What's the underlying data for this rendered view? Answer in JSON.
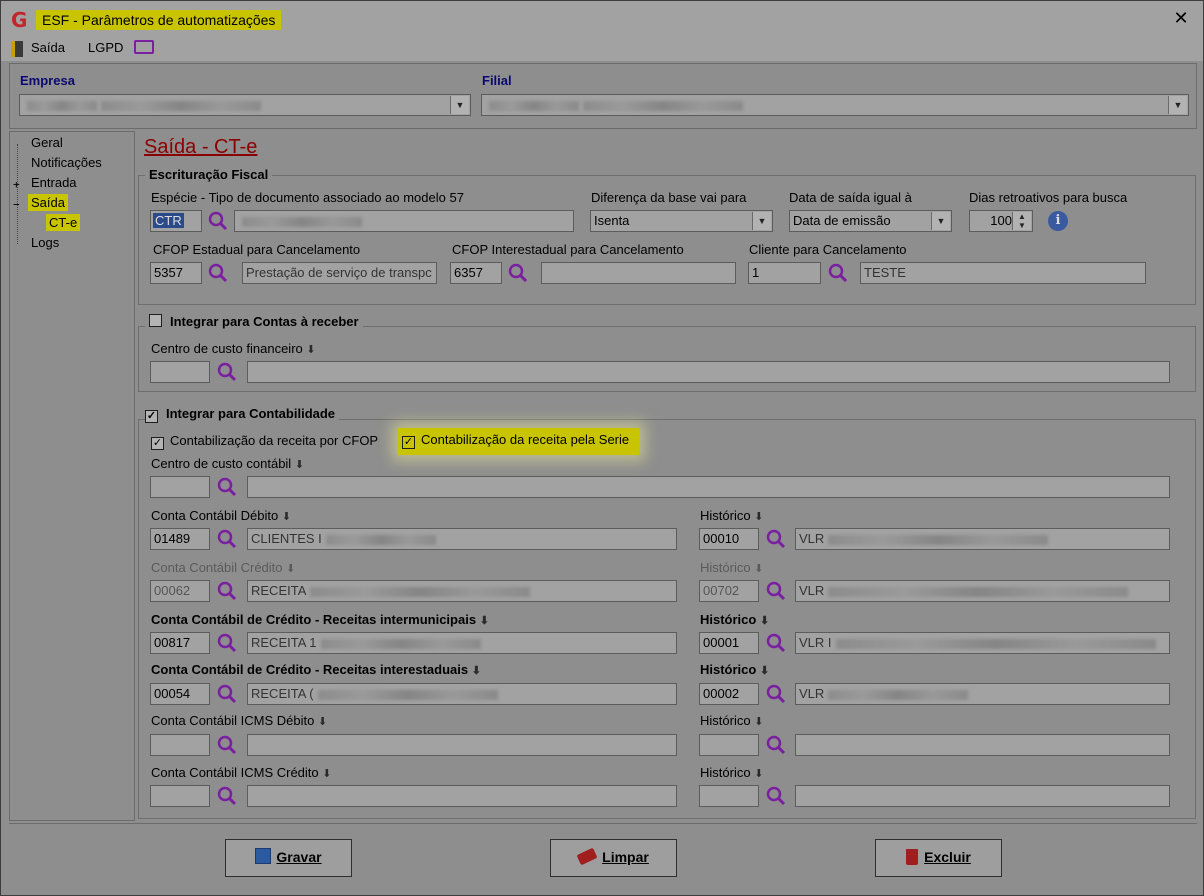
{
  "window": {
    "title": "ESF - Parâmetros de automatizações",
    "close_glyph": "✕"
  },
  "menu": {
    "saida": "Saída",
    "lgpd": "LGPD"
  },
  "header": {
    "empresa_label": "Empresa",
    "filial_label": "Filial"
  },
  "tree": {
    "items": [
      "Geral",
      "Notificações",
      "Entrada",
      "Saída",
      "CT-e",
      "Logs"
    ]
  },
  "page": {
    "title": "Saída - CT-e"
  },
  "escrituracao": {
    "title": "Escrituração Fiscal",
    "especie_label": "Espécie - Tipo de documento associado ao modelo 57",
    "especie_code": "CTR",
    "diferenca_label": "Diferença da base vai para",
    "diferenca_value": "Isenta",
    "data_saida_label": "Data de saída igual à",
    "data_saida_value": "Data de emissão",
    "dias_label": "Dias retroativos para busca",
    "dias_value": "100",
    "cfop_est_label": "CFOP Estadual para  Cancelamento",
    "cfop_est_code": "5357",
    "cfop_est_desc": "Prestação de serviço de transpc",
    "cfop_inter_label": "CFOP Interestadual para  Cancelamento",
    "cfop_inter_code": "6357",
    "cliente_label": "Cliente para Cancelamento",
    "cliente_code": "1",
    "cliente_desc": "TESTE"
  },
  "contas_receber": {
    "title": "Integrar para Contas à receber",
    "checked": false,
    "centro_label": "Centro de custo financeiro"
  },
  "contabilidade": {
    "title": "Integrar para Contabilidade",
    "checked": true,
    "opt_cfop": "Contabilização da receita por CFOP",
    "opt_serie": "Contabilização da receita pela Serie",
    "centro_label": "Centro de custo contábil",
    "debito_label": "Conta Contábil Débito",
    "debito_code": "01489",
    "debito_desc": "CLIENTES I",
    "hist1_label": "Histórico",
    "hist1_code": "00010",
    "hist1_desc": "VLR",
    "credito_label": "Conta Contábil Crédito",
    "credito_code": "00062",
    "credito_desc": "RECEITA",
    "hist2_label": "Histórico",
    "hist2_code": "00702",
    "hist2_desc": "VLR",
    "inter_mun_label": "Conta Contábil de Crédito - Receitas intermunicipais",
    "inter_mun_code": "00817",
    "inter_mun_desc": "RECEITA 1",
    "hist3_label": "Histórico",
    "hist3_code": "00001",
    "hist3_desc": "VLR I",
    "inter_est_label": "Conta Contábil de Crédito - Receitas interestaduais",
    "inter_est_code": "00054",
    "inter_est_desc": "RECEITA (",
    "hist4_label": "Histórico",
    "hist4_code": "00002",
    "hist4_desc": "VLR",
    "icms_deb_label": "Conta Contábil ICMS Débito",
    "hist5_label": "Histórico",
    "icms_cred_label": "Conta Contábil ICMS Crédito",
    "hist6_label": "Histórico"
  },
  "buttons": {
    "gravar": "Gravar",
    "limpar": "Limpar",
    "excluir": "Excluir"
  },
  "colors": {
    "highlight": "#c8c400",
    "accent": "#7a1fa0",
    "title_red": "#8b0000"
  }
}
